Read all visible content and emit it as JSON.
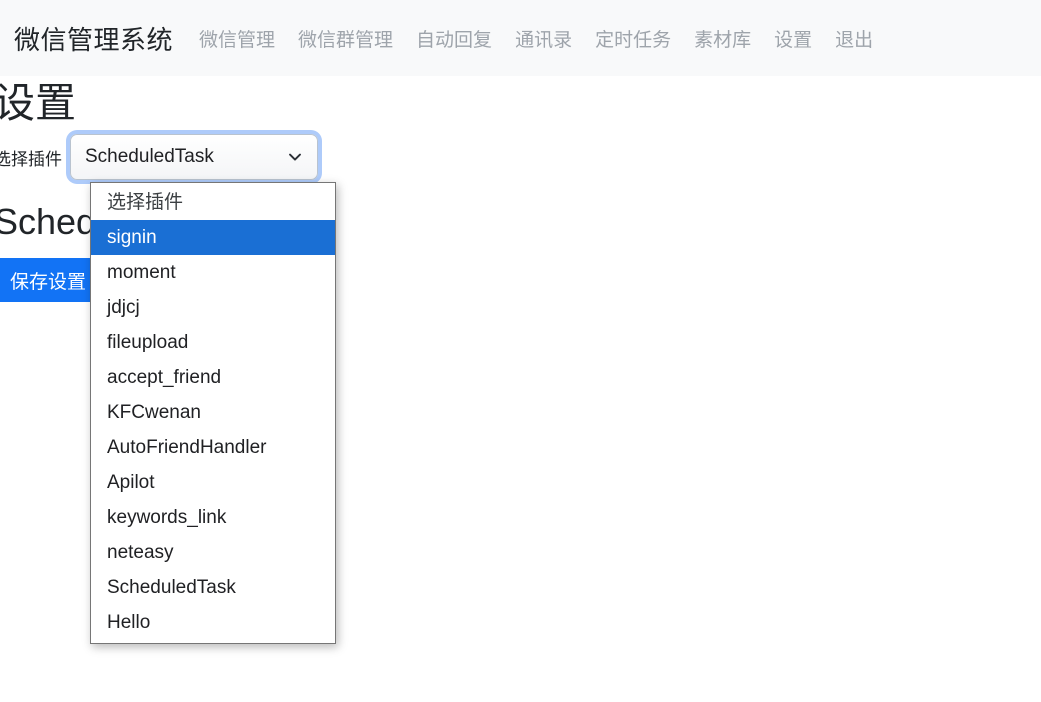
{
  "header": {
    "brand": "微信管理系统",
    "nav_items": [
      {
        "label": "微信管理"
      },
      {
        "label": "微信群管理"
      },
      {
        "label": "自动回复"
      },
      {
        "label": "通讯录"
      },
      {
        "label": "定时任务"
      },
      {
        "label": "素材库"
      },
      {
        "label": "设置"
      },
      {
        "label": "退出"
      }
    ],
    "background_color": "#f8f9fa",
    "nav_link_color": "#9ea4ab"
  },
  "main": {
    "page_title": "设置",
    "select_label": "选择插件",
    "selected_plugin": "ScheduledTask",
    "chevron_icon": "chevron-down-icon",
    "focus_ring_color": "#aecbfa",
    "plugin_heading": "ScheduledTask 设置",
    "save_button_label": "保存设置",
    "save_button_color": "#1273f5"
  },
  "dropdown": {
    "open": true,
    "highlight_color": "#1a6fd4",
    "highlighted_index": 1,
    "options": [
      {
        "label": "选择插件",
        "placeholder": true
      },
      {
        "label": "signin"
      },
      {
        "label": "moment"
      },
      {
        "label": "jdjcj"
      },
      {
        "label": "fileupload"
      },
      {
        "label": "accept_friend"
      },
      {
        "label": "KFCwenan"
      },
      {
        "label": "AutoFriendHandler"
      },
      {
        "label": "Apilot"
      },
      {
        "label": "keywords_link"
      },
      {
        "label": "neteasy"
      },
      {
        "label": "ScheduledTask"
      },
      {
        "label": "Hello"
      }
    ]
  }
}
